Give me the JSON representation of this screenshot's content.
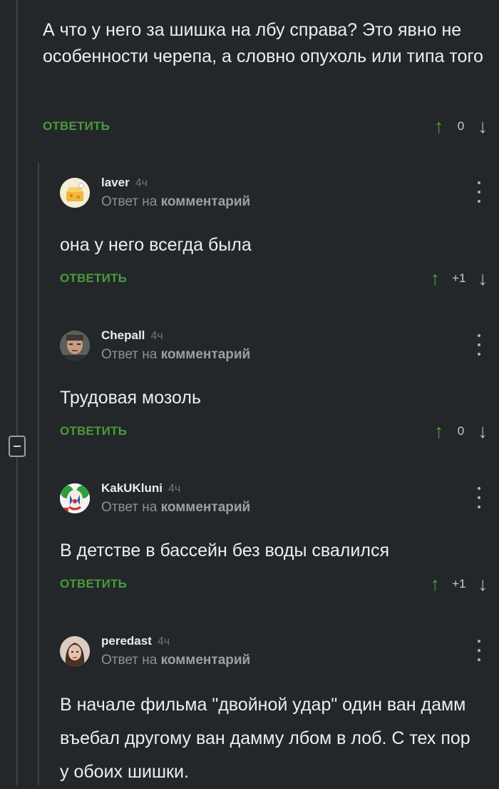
{
  "top_comment": {
    "text": "А что у него за шишка на лбу справа? Это явно не особенности черепа, а словно опухоль или типа того",
    "reply_label": "ОТВЕТИТЬ",
    "votes": "0"
  },
  "replies": [
    {
      "username": "laver",
      "time": "4ч",
      "reply_to": "Ответ на",
      "reply_to_bold": "комментарий",
      "text": "она у него всегда была",
      "reply_label": "ОТВЕТИТЬ",
      "votes": "+1"
    },
    {
      "username": "Chepall",
      "time": "4ч",
      "reply_to": "Ответ на",
      "reply_to_bold": "комментарий",
      "text": "Трудовая мозоль",
      "reply_label": "ОТВЕТИТЬ",
      "votes": "0"
    },
    {
      "username": "KakUKluni",
      "time": "4ч",
      "reply_to": "Ответ на",
      "reply_to_bold": "комментарий",
      "text": "В детстве в бассейн без воды свалился",
      "reply_label": "ОТВЕТИТЬ",
      "votes": "+1"
    },
    {
      "username": "peredast",
      "time": "4ч",
      "reply_to": "Ответ на",
      "reply_to_bold": "комментарий",
      "text": "В начале фильма \"двойной удар\" один ван дамм въебал другому ван дамму лбом в лоб. С тех пор у обоих шишки.",
      "reply_label": "",
      "votes": ""
    }
  ],
  "icons": {
    "upvote": "arrow-up-icon",
    "downvote": "arrow-down-icon",
    "more": "kebab-menu-icon",
    "collapse": "collapse-minus-icon"
  },
  "colors": {
    "background": "#24272a",
    "accent_green": "#4a9a3a",
    "muted": "#8b9197"
  }
}
